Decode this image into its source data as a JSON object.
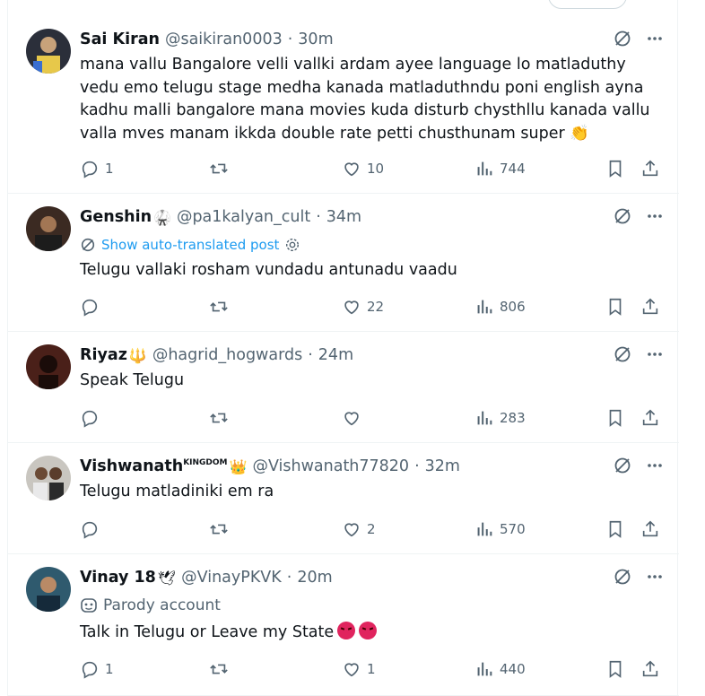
{
  "colors": {
    "text": "#0f1419",
    "muted": "#536471",
    "link": "#1d9bf0",
    "border": "#eff3f4"
  },
  "tweets": [
    {
      "name": "Sai Kiran",
      "name_emoji": "",
      "handle": "@saikiran0003",
      "sep": "·",
      "time": "30m",
      "body": "mana vallu Bangalore velli vallki ardam ayee language lo matladuthy vedu emo telugu stage medha kanada matladuthndu poni english ayna kadhu malli bangalore mana movies kuda disturb chysthllu kanada vallu valla mves manam ikkda double rate petti chusthunam super 👏",
      "replies": "1",
      "reposts": "",
      "likes": "10",
      "views": "744"
    },
    {
      "name": "Genshin",
      "name_emoji": "🥋",
      "handle": "@pa1kalyan_cult",
      "sep": "·",
      "time": "34m",
      "translate": "Show auto-translated post",
      "body": "Telugu vallaki rosham vundadu antunadu vaadu",
      "replies": "",
      "reposts": "",
      "likes": "22",
      "views": "806"
    },
    {
      "name": "Riyaz",
      "name_emoji": "🔱",
      "handle": "@hagrid_hogwards",
      "sep": "·",
      "time": "24m",
      "body": "Speak Telugu",
      "replies": "",
      "reposts": "",
      "likes": "",
      "views": "283"
    },
    {
      "name": "Vishwanath",
      "name_sup": "KINGDOM",
      "name_emoji": "👑",
      "handle": "@Vishwanath77820",
      "sep": "·",
      "time": "32m",
      "body": "Telugu matladiniki em ra",
      "replies": "",
      "reposts": "",
      "likes": "2",
      "views": "570"
    },
    {
      "name": "Vinay 18",
      "name_emoji": "🕊",
      "handle": "@VinayPKVK",
      "sep": "·",
      "time": "20m",
      "parody": "Parody account",
      "body": "Talk in Telugu or Leave my State",
      "replies": "1",
      "reposts": "",
      "likes": "1",
      "views": "440"
    }
  ]
}
